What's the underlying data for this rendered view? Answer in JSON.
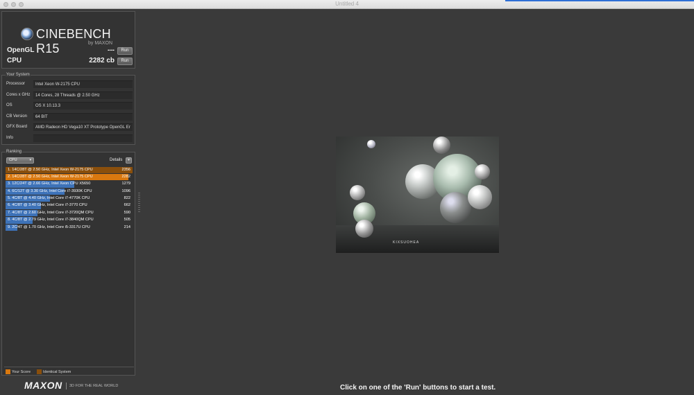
{
  "window": {
    "title": "Untitled 4"
  },
  "logo": {
    "name": "CINEBENCH R15",
    "sub": "by MAXON"
  },
  "scores": [
    {
      "label": "OpenGL",
      "value": "---",
      "button": "Run"
    },
    {
      "label": "CPU",
      "value": "2282 cb",
      "button": "Run"
    }
  ],
  "system": {
    "title": "Your System",
    "rows": [
      {
        "key": "Processor",
        "value": "Intel Xeon W-2175 CPU"
      },
      {
        "key": "Cores x GHz",
        "value": "14 Cores, 28 Threads @ 2.50 GHz"
      },
      {
        "key": "OS",
        "value": "OS X 10.13.3"
      },
      {
        "key": "CB Version",
        "value": "64 BIT"
      },
      {
        "key": "GFX Board",
        "value": "AMD Radeon HD Vega10 XT Prototype OpenGL Er"
      },
      {
        "key": "Info",
        "value": ""
      }
    ]
  },
  "ranking": {
    "title": "Ranking",
    "select": "CPU",
    "details_label": "Details",
    "details_button": "▾",
    "rows": [
      {
        "label": "1. 14C/28T @ 2.50 GHz, Intel Xeon W-2175 CPU",
        "score": "2356",
        "kind": "identical"
      },
      {
        "label": "2. 14C/28T @ 2.50 GHz, Intel Xeon W-2175 CPU",
        "score": "2282",
        "kind": "yours"
      },
      {
        "label": "3. 12C/24T @ 2.66 GHz, Intel Xeon CPU X5650",
        "score": "1279",
        "kind": "other"
      },
      {
        "label": "4. 6C/12T @ 3.30 GHz,  Intel Core i7-3930K CPU",
        "score": "1096",
        "kind": "other"
      },
      {
        "label": "5. 4C/8T @ 4.40 GHz, Intel Core i7-4770K CPU",
        "score": "822",
        "kind": "other"
      },
      {
        "label": "6. 4C/8T @ 3.40 GHz, Intel Core i7-3770 CPU",
        "score": "662",
        "kind": "other"
      },
      {
        "label": "7. 4C/8T @ 2.60 GHz, Intel Core i7-3720QM CPU",
        "score": "590",
        "kind": "other"
      },
      {
        "label": "8. 4C/8T @ 2.79 GHz,  Intel Core i7-3840QM CPU",
        "score": "505",
        "kind": "other"
      },
      {
        "label": "9. 2C/4T @ 1.70 GHz,  Intel Core i5-3317U CPU",
        "score": "214",
        "kind": "other"
      }
    ],
    "legend": [
      {
        "label": "Your Score",
        "color": "#d9780f"
      },
      {
        "label": "Identical System",
        "color": "#8a4f0c"
      }
    ],
    "colors": {
      "yours": "#d9780f",
      "identical": "#8a4f0c",
      "other": "#3d72b8"
    }
  },
  "footer": {
    "brand": "MAXON",
    "tagline": "3D FOR THE REAL WORLD",
    "hint": "Click on one of the 'Run' buttons to start a test."
  },
  "render": {
    "brand": "KIXSUOHEA"
  }
}
